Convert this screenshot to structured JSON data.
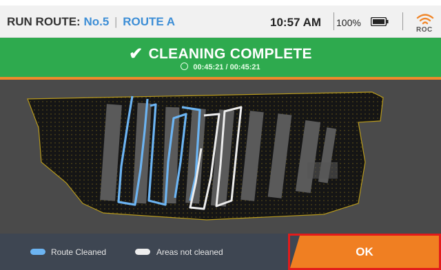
{
  "header": {
    "run_route_label": "RUN ROUTE:",
    "route_number": "No.5",
    "separator": "|",
    "route_name": "ROUTE A",
    "time": "10:57 AM",
    "battery": "100%",
    "battery_icon": "battery-full-icon",
    "wifi_icon": "wifi-icon",
    "roc_label": "ROC"
  },
  "banner": {
    "title": "CLEANING COMPLETE",
    "check_icon": "checkmark-icon",
    "clock_icon": "clock-icon",
    "elapsed": "00:45:21 / 00:45:21",
    "color": "#2eaa4e"
  },
  "legend": {
    "cleaned_label": "Route Cleaned",
    "cleaned_color": "#6cb4f2",
    "not_cleaned_label": "Areas not cleaned",
    "not_cleaned_color": "#ededed"
  },
  "actions": {
    "ok_label": "OK",
    "ok_color": "#f07f22"
  },
  "colors": {
    "accent_orange": "#ef8a2c",
    "footer_bg": "#3e4652",
    "map_bg": "#4a4a4a",
    "highlight_red": "#e21b1b"
  }
}
